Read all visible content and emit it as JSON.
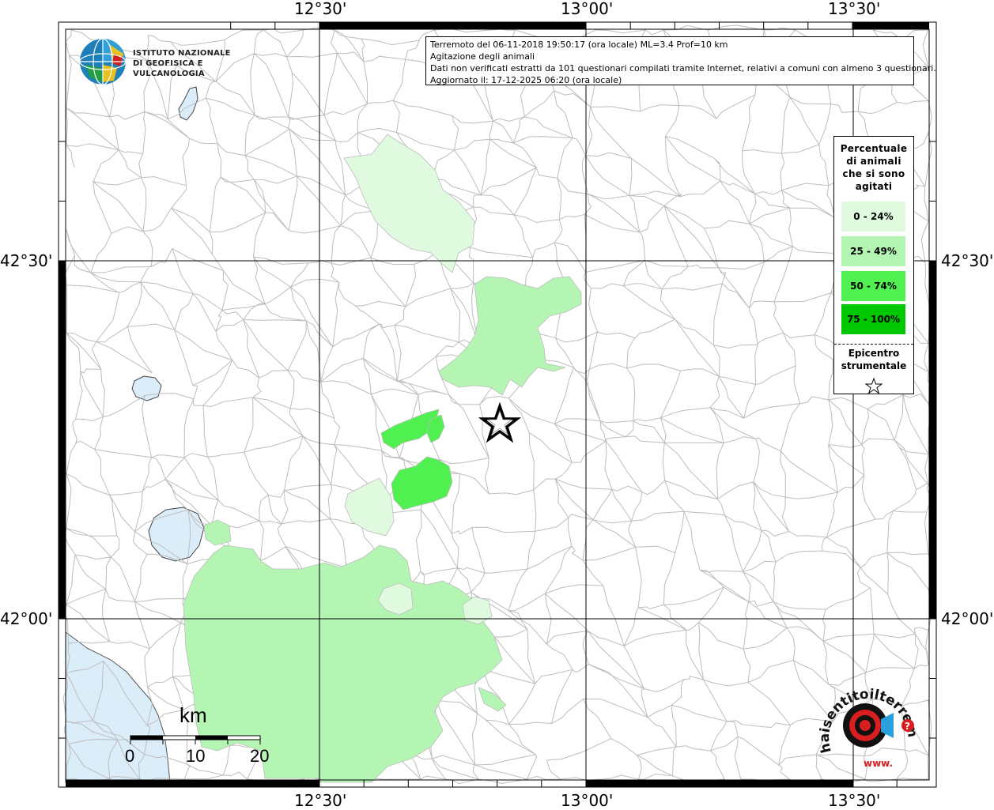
{
  "title_lines": [
    "Terremoto del 06-11-2018 19:50:17 (ora locale) ML=3.4 Prof=10 km",
    "Agitazione degli animali",
    "Dati non verificati estratti da 101 questionari compilati tramite Internet, relativi a comuni con almeno 3 questionari.",
    "Aggiornato il: 17-12-2025 06:20 (ora locale)"
  ],
  "ingv_logo": {
    "line1": "ISTITUTO NAZIONALE",
    "line2": "DI GEOFISICA E VULCANOLOGIA"
  },
  "axes": {
    "top": [
      "12°30'",
      "13°00'",
      "13°30'"
    ],
    "bottom": [
      "12°30'",
      "13°00'",
      "13°30'"
    ],
    "left": [
      "42°30'",
      "42°00'"
    ],
    "right": [
      "42°30'",
      "42°00'"
    ]
  },
  "legend": {
    "title": "Percentuale di animali che si sono agitati",
    "classes": [
      {
        "label": "0 - 24%",
        "color": "#e0fae0"
      },
      {
        "label": "25 - 49%",
        "color": "#b4f5b4"
      },
      {
        "label": "50 - 74%",
        "color": "#50f050"
      },
      {
        "label": "75 - 100%",
        "color": "#00c800"
      }
    ],
    "epicenter_label": "Epicentro strumentale"
  },
  "scale_bar": {
    "unit": "km",
    "ticks": [
      "0",
      "10",
      "20"
    ]
  },
  "hsit_logo": {
    "text": "haisentitoilterremoto.it",
    "prefix": "www."
  },
  "colors": {
    "sea": "#dcedfa",
    "lake": "#dcedfa",
    "border": "#bbbbbb",
    "grid": "#000000"
  }
}
